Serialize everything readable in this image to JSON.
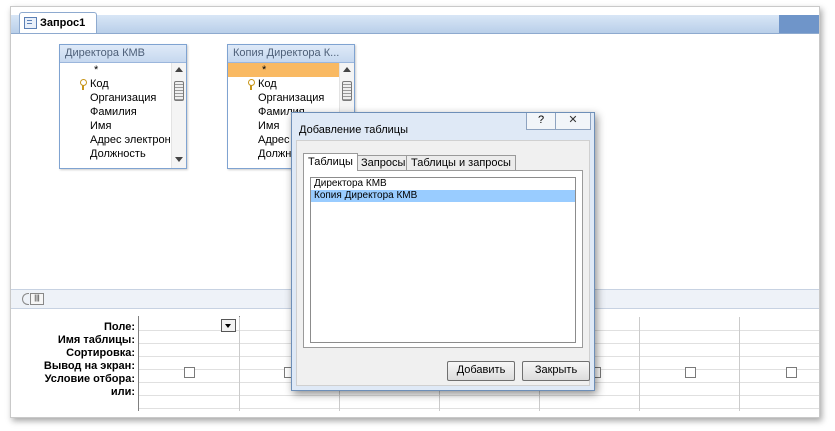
{
  "query_tab": {
    "title": "Запрос1"
  },
  "table1": {
    "title": "Директора КМВ",
    "fields": [
      "*",
      "Код",
      "Организация",
      "Фамилия",
      "Имя",
      "Адрес электрон",
      "Должность"
    ]
  },
  "table2": {
    "title": "Копия Директора К...",
    "fields": [
      "*",
      "Код",
      "Организация",
      "Фамилия",
      "Имя",
      "Адрес",
      "Должн"
    ]
  },
  "grid": {
    "labels": [
      "Поле:",
      "Имя таблицы:",
      "Сортировка:",
      "Вывод на экран:",
      "Условие отбора:",
      "или:"
    ]
  },
  "dialog": {
    "title": "Добавление таблицы",
    "help": "?",
    "close": "✕",
    "tabs": [
      "Таблицы",
      "Запросы",
      "Таблицы и запросы"
    ],
    "list": [
      "Директора КМВ",
      "Копия Директора КМВ"
    ],
    "selected_index": 1,
    "add_label": "Добавить",
    "close_label": "Закрыть"
  },
  "colors": {
    "accent": "#6f95c9",
    "selection": "#99ccff",
    "field_highlight": "#f9b962"
  }
}
